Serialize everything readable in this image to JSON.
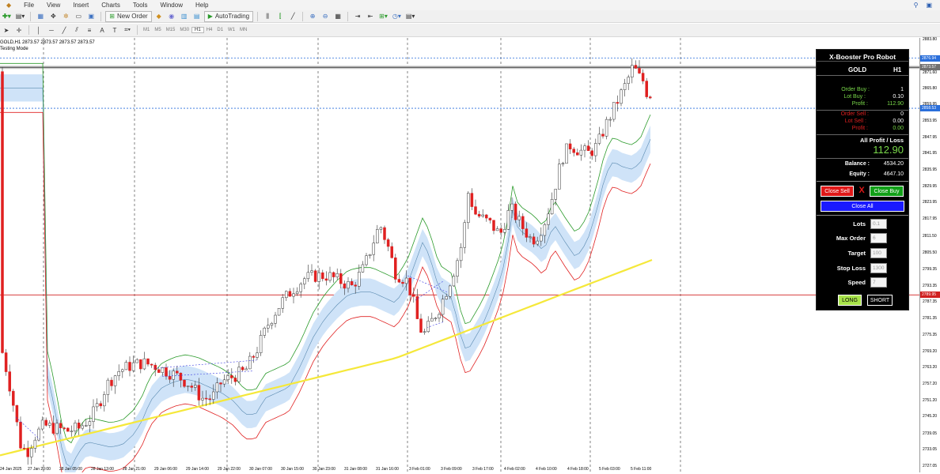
{
  "menu": [
    "File",
    "View",
    "Insert",
    "Charts",
    "Tools",
    "Window",
    "Help"
  ],
  "toolbar": {
    "new_order": "New Order",
    "auto_trading": "AutoTrading"
  },
  "timeframes": [
    "M1",
    "M5",
    "M15",
    "M30",
    "H1",
    "H4",
    "D1",
    "W1",
    "MN"
  ],
  "active_timeframe": "H1",
  "chart": {
    "symbol_line": "GOLD,H1  2873.57 2873.57 2873.57 2873.57",
    "mode_line": "Testing Mode",
    "price_ticks": [
      "2883.80",
      "2877.25",
      "2871.60",
      "2865.80",
      "2859.95",
      "2853.95",
      "2847.95",
      "2841.95",
      "2835.95",
      "2829.95",
      "2823.95",
      "2817.95",
      "2811.50",
      "2805.50",
      "2799.35",
      "2793.35",
      "2787.35",
      "2781.35",
      "2775.35",
      "2769.20",
      "2763.20",
      "2757.20",
      "2751.20",
      "2745.20",
      "2739.05",
      "2733.05",
      "2727.05"
    ],
    "tags": [
      {
        "label": "2876.94",
        "color": "#2a6fdb"
      },
      {
        "label": "2873.57",
        "color": "#707070"
      },
      {
        "label": "2858.53",
        "color": "#2a6fdb"
      },
      {
        "label": "2789.95",
        "color": "#d02020"
      }
    ],
    "time_labels": [
      "24 Jan 2025",
      "27 Jan 20:00",
      "28 Jan 05:00",
      "28 Jan 13:00",
      "28 Jan 21:00",
      "29 Jan 06:00",
      "29 Jan 14:00",
      "29 Jan 22:00",
      "30 Jan 07:00",
      "30 Jan 15:00",
      "30 Jan 23:00",
      "31 Jan 08:00",
      "31 Jan 16:00",
      "3 Feb 01:00",
      "3 Feb 09:00",
      "3 Feb 17:00",
      "4 Feb 02:00",
      "4 Feb 10:00",
      "4 Feb 18:00",
      "5 Feb 03:00",
      "5 Feb 11:00"
    ]
  },
  "panel": {
    "title": "X-Booster Pro Robot",
    "symbol": "GOLD",
    "timeframe": "H1",
    "order_buy_label": "Order Buy :",
    "order_buy": "1",
    "lot_buy_label": "Lot Buy :",
    "lot_buy": "0.10",
    "profit_buy_label": "Profit :",
    "profit_buy": "112.90",
    "order_sell_label": "Order Sell :",
    "order_sell": "0",
    "lot_sell_label": "Lot Sell :",
    "lot_sell": "0.00",
    "profit_sell_label": "Profit :",
    "profit_sell": "0.00",
    "all_pl_label": "All Profit / Loss",
    "all_pl": "112.90",
    "balance_label": "Balance :",
    "balance": "4534.20",
    "equity_label": "Equity :",
    "equity": "4647.10",
    "close_sell": "Close Sell",
    "x_mark": "X",
    "close_buy": "Close Buy",
    "close_all": "Close All",
    "lots_label": "Lots",
    "lots": "0.1",
    "max_order_label": "Max Order",
    "max_order": "6",
    "target_label": "Target",
    "target": "100",
    "stop_loss_label": "Stop Loss",
    "stop_loss": "1300",
    "speed_label": "Speed",
    "speed": "7",
    "long": "LONG",
    "short": "SHORT"
  }
}
